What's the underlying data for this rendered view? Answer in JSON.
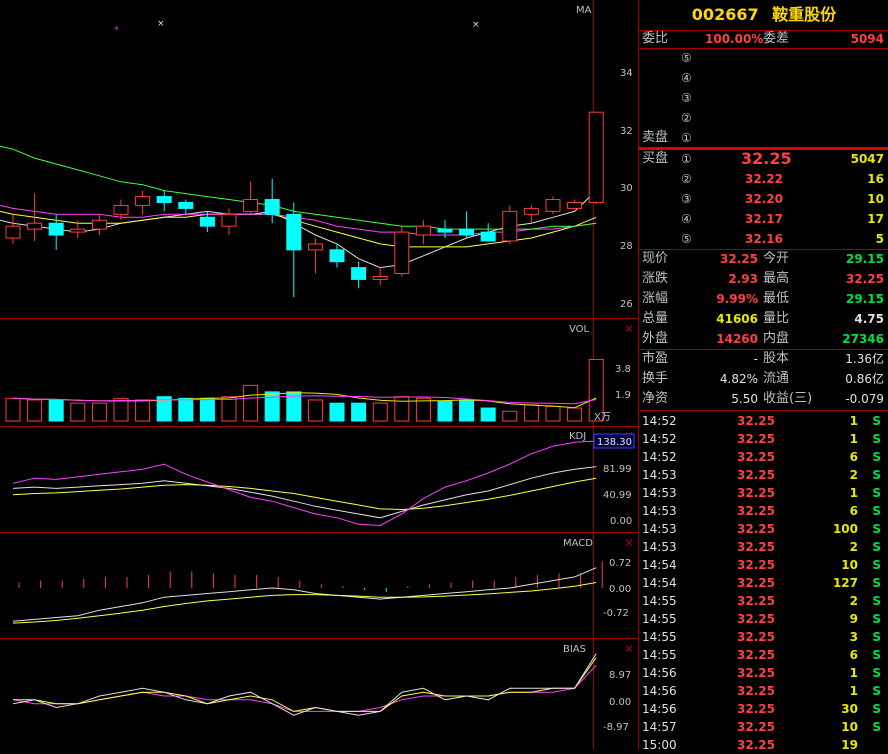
{
  "stock": {
    "code": "002667",
    "name": "鞍重股份"
  },
  "weibi": {
    "label1": "委比",
    "value1": "100.00%",
    "label2": "委差",
    "value2": "5094"
  },
  "sell": {
    "label": "卖盘",
    "levels": [
      {
        "idx": "⑤",
        "price": "",
        "vol": ""
      },
      {
        "idx": "④",
        "price": "",
        "vol": ""
      },
      {
        "idx": "③",
        "price": "",
        "vol": ""
      },
      {
        "idx": "②",
        "price": "",
        "vol": ""
      },
      {
        "idx": "①",
        "price": "",
        "vol": ""
      }
    ]
  },
  "buy": {
    "label": "买盘",
    "levels": [
      {
        "idx": "①",
        "price": "32.25",
        "vol": "5047"
      },
      {
        "idx": "②",
        "price": "32.22",
        "vol": "16"
      },
      {
        "idx": "③",
        "price": "32.20",
        "vol": "10"
      },
      {
        "idx": "④",
        "price": "32.17",
        "vol": "17"
      },
      {
        "idx": "⑤",
        "price": "32.16",
        "vol": "5"
      }
    ]
  },
  "quote": [
    {
      "l1": "现价",
      "v1": "32.25",
      "c1": "red",
      "l2": "今开",
      "v2": "29.15",
      "c2": "green"
    },
    {
      "l1": "涨跌",
      "v1": "2.93",
      "c1": "red",
      "l2": "最高",
      "v2": "32.25",
      "c2": "red"
    },
    {
      "l1": "涨幅",
      "v1": "9.99%",
      "c1": "red",
      "l2": "最低",
      "v2": "29.15",
      "c2": "green"
    },
    {
      "l1": "总量",
      "v1": "41606",
      "c1": "yellow",
      "l2": "量比",
      "v2": "4.75",
      "c2": "white"
    },
    {
      "l1": "外盘",
      "v1": "14260",
      "c1": "red",
      "l2": "内盘",
      "v2": "27346",
      "c2": "green"
    }
  ],
  "fund": [
    {
      "l1": "市盈",
      "v1": "-",
      "l2": "股本",
      "v2": "1.36亿"
    },
    {
      "l1": "换手",
      "v1": "4.82%",
      "l2": "流通",
      "v2": "0.86亿"
    },
    {
      "l1": "净资",
      "v1": "5.50",
      "l2": "收益(三)",
      "v2": "-0.079"
    }
  ],
  "ticks": [
    {
      "time": "14:52",
      "price": "32.25",
      "vol": "1",
      "side": "S"
    },
    {
      "time": "14:52",
      "price": "32.25",
      "vol": "1",
      "side": "S"
    },
    {
      "time": "14:52",
      "price": "32.25",
      "vol": "6",
      "side": "S"
    },
    {
      "time": "14:53",
      "price": "32.25",
      "vol": "2",
      "side": "S"
    },
    {
      "time": "14:53",
      "price": "32.25",
      "vol": "1",
      "side": "S"
    },
    {
      "time": "14:53",
      "price": "32.25",
      "vol": "6",
      "side": "S"
    },
    {
      "time": "14:53",
      "price": "32.25",
      "vol": "100",
      "side": "S"
    },
    {
      "time": "14:53",
      "price": "32.25",
      "vol": "2",
      "side": "S"
    },
    {
      "time": "14:54",
      "price": "32.25",
      "vol": "10",
      "side": "S"
    },
    {
      "time": "14:54",
      "price": "32.25",
      "vol": "127",
      "side": "S"
    },
    {
      "time": "14:55",
      "price": "32.25",
      "vol": "2",
      "side": "S"
    },
    {
      "time": "14:55",
      "price": "32.25",
      "vol": "9",
      "side": "S"
    },
    {
      "time": "14:55",
      "price": "32.25",
      "vol": "3",
      "side": "S"
    },
    {
      "time": "14:55",
      "price": "32.25",
      "vol": "6",
      "side": "S"
    },
    {
      "time": "14:56",
      "price": "32.25",
      "vol": "1",
      "side": "S"
    },
    {
      "time": "14:56",
      "price": "32.25",
      "vol": "1",
      "side": "S"
    },
    {
      "time": "14:56",
      "price": "32.25",
      "vol": "30",
      "side": "S"
    },
    {
      "time": "14:57",
      "price": "32.25",
      "vol": "10",
      "side": "S"
    },
    {
      "time": "15:00",
      "price": "32.25",
      "vol": "19",
      "side": ""
    }
  ],
  "panels": {
    "ma": {
      "label": "MA",
      "ticks": [
        "34",
        "32",
        "30",
        "28",
        "26"
      ]
    },
    "vol": {
      "label": "VOL",
      "ticks": [
        "3.8",
        "1.9"
      ],
      "unit": "X万"
    },
    "kdj": {
      "label": "KDJ",
      "ticks": [
        "81.99",
        "40.99",
        "0.00"
      ],
      "current": "138.30"
    },
    "macd": {
      "label": "MACD",
      "ticks": [
        "0.72",
        "0.00",
        "-0.72"
      ]
    },
    "bias": {
      "label": "BIAS",
      "ticks": [
        "8.97",
        "0.00",
        "-8.97"
      ]
    }
  },
  "chart_data": {
    "type": "candlestick",
    "ylim": [
      25.5,
      35.5
    ],
    "candles": [
      {
        "o": 28.0,
        "h": 28.8,
        "l": 27.8,
        "c": 28.4
      },
      {
        "o": 28.3,
        "h": 29.5,
        "l": 27.9,
        "c": 28.5
      },
      {
        "o": 28.5,
        "h": 28.8,
        "l": 27.6,
        "c": 28.1
      },
      {
        "o": 28.2,
        "h": 28.6,
        "l": 28.0,
        "c": 28.3
      },
      {
        "o": 28.3,
        "h": 28.8,
        "l": 28.1,
        "c": 28.6
      },
      {
        "o": 28.8,
        "h": 29.3,
        "l": 28.6,
        "c": 29.1
      },
      {
        "o": 29.1,
        "h": 29.6,
        "l": 28.8,
        "c": 29.4
      },
      {
        "o": 29.4,
        "h": 29.6,
        "l": 28.9,
        "c": 29.2
      },
      {
        "o": 29.2,
        "h": 29.3,
        "l": 28.8,
        "c": 29.0
      },
      {
        "o": 28.7,
        "h": 28.9,
        "l": 28.2,
        "c": 28.4
      },
      {
        "o": 28.4,
        "h": 29.0,
        "l": 28.1,
        "c": 28.8
      },
      {
        "o": 28.9,
        "h": 29.9,
        "l": 28.8,
        "c": 29.3
      },
      {
        "o": 29.3,
        "h": 30.0,
        "l": 28.5,
        "c": 28.8
      },
      {
        "o": 28.8,
        "h": 29.2,
        "l": 26.0,
        "c": 27.6
      },
      {
        "o": 27.6,
        "h": 28.0,
        "l": 26.8,
        "c": 27.8
      },
      {
        "o": 27.6,
        "h": 27.8,
        "l": 27.0,
        "c": 27.2
      },
      {
        "o": 27.0,
        "h": 27.2,
        "l": 26.3,
        "c": 26.6
      },
      {
        "o": 26.6,
        "h": 27.0,
        "l": 26.4,
        "c": 26.7
      },
      {
        "o": 26.8,
        "h": 28.4,
        "l": 26.7,
        "c": 28.2
      },
      {
        "o": 28.1,
        "h": 28.6,
        "l": 27.8,
        "c": 28.4
      },
      {
        "o": 28.3,
        "h": 28.6,
        "l": 28.0,
        "c": 28.2
      },
      {
        "o": 28.3,
        "h": 28.9,
        "l": 28.0,
        "c": 28.1
      },
      {
        "o": 28.2,
        "h": 28.5,
        "l": 27.9,
        "c": 27.9
      },
      {
        "o": 27.9,
        "h": 29.1,
        "l": 27.8,
        "c": 28.9
      },
      {
        "o": 28.8,
        "h": 29.1,
        "l": 28.5,
        "c": 29.0
      },
      {
        "o": 28.9,
        "h": 29.4,
        "l": 28.8,
        "c": 29.3
      },
      {
        "o": 29.0,
        "h": 29.3,
        "l": 29.0,
        "c": 29.2
      },
      {
        "o": 29.2,
        "h": 32.25,
        "l": 29.15,
        "c": 32.25
      }
    ],
    "ma": [
      {
        "color": "#e0e0e0",
        "values": [
          28.5,
          28.4,
          28.3,
          28.2,
          28.3,
          28.5,
          28.6,
          28.7,
          28.8,
          28.9,
          28.8,
          28.8,
          28.9,
          28.5,
          28.1,
          27.8,
          27.3,
          27.0,
          27.1,
          27.4,
          27.7,
          28.0,
          28.2,
          28.4,
          28.5,
          28.7,
          28.9,
          29.6
        ]
      },
      {
        "color": "#ffff40",
        "values": [
          28.8,
          28.7,
          28.6,
          28.5,
          28.5,
          28.5,
          28.6,
          28.7,
          28.7,
          28.8,
          28.8,
          28.8,
          28.8,
          28.6,
          28.4,
          28.2,
          28.0,
          27.8,
          27.7,
          27.7,
          27.7,
          27.7,
          27.8,
          27.9,
          28.0,
          28.2,
          28.4,
          28.7
        ]
      },
      {
        "color": "#ff40ff",
        "values": [
          29.0,
          28.9,
          28.8,
          28.8,
          28.8,
          28.7,
          28.7,
          28.8,
          28.8,
          28.8,
          28.8,
          28.8,
          28.8,
          28.7,
          28.6,
          28.4,
          28.3,
          28.2,
          28.2,
          28.1,
          28.1,
          28.1,
          28.2,
          28.2,
          28.3,
          28.3,
          28.4,
          28.5
        ]
      },
      {
        "color": "#40ff40",
        "values": [
          31.0,
          30.7,
          30.5,
          30.3,
          30.1,
          29.9,
          29.8,
          29.6,
          29.5,
          29.4,
          29.3,
          29.2,
          29.1,
          28.9,
          28.8,
          28.7,
          28.6,
          28.5,
          28.4,
          28.4,
          28.3,
          28.3,
          28.3,
          28.3,
          28.3,
          28.4,
          28.4,
          28.5
        ]
      }
    ],
    "volume": {
      "ylim": [
        0,
        5.0
      ],
      "values": [
        1.4,
        1.3,
        1.3,
        1.1,
        1.1,
        1.4,
        1.3,
        1.5,
        1.4,
        1.4,
        1.5,
        2.2,
        1.8,
        1.8,
        1.3,
        1.1,
        1.1,
        1.1,
        1.5,
        1.4,
        1.2,
        1.3,
        0.8,
        0.6,
        1.0,
        0.9,
        0.8,
        3.8
      ]
    },
    "kdj": {
      "ylim": [
        -5,
        145
      ],
      "k": [
        60,
        62,
        60,
        62,
        64,
        66,
        68,
        72,
        68,
        64,
        60,
        54,
        48,
        40,
        32,
        26,
        20,
        14,
        24,
        34,
        42,
        50,
        56,
        66,
        76,
        84,
        90,
        94
      ],
      "d": [
        50,
        52,
        53,
        55,
        57,
        59,
        62,
        65,
        66,
        65,
        63,
        60,
        56,
        52,
        46,
        40,
        34,
        28,
        27,
        29,
        33,
        38,
        43,
        49,
        56,
        63,
        70,
        76
      ],
      "j": [
        68,
        76,
        74,
        78,
        82,
        86,
        90,
        98,
        82,
        70,
        58,
        46,
        40,
        30,
        20,
        14,
        4,
        2,
        20,
        44,
        62,
        72,
        84,
        98,
        114,
        126,
        132,
        134
      ]
    },
    "macd": {
      "ylim": [
        -1.3,
        1.3
      ],
      "hist": [
        0.15,
        0.2,
        0.2,
        0.25,
        0.3,
        0.3,
        0.35,
        0.45,
        0.45,
        0.4,
        0.35,
        0.35,
        0.3,
        0.2,
        0.1,
        0.05,
        -0.05,
        -0.1,
        0.05,
        0.1,
        0.15,
        0.2,
        0.2,
        0.3,
        0.35,
        0.4,
        0.4,
        0.72
      ],
      "dif": [
        -0.9,
        -0.85,
        -0.8,
        -0.75,
        -0.6,
        -0.5,
        -0.4,
        -0.25,
        -0.2,
        -0.15,
        -0.1,
        -0.05,
        0.0,
        -0.05,
        -0.15,
        -0.2,
        -0.25,
        -0.3,
        -0.25,
        -0.2,
        -0.15,
        -0.1,
        -0.05,
        0.0,
        0.1,
        0.2,
        0.3,
        0.55
      ],
      "dea": [
        -0.95,
        -0.92,
        -0.88,
        -0.82,
        -0.75,
        -0.68,
        -0.6,
        -0.5,
        -0.42,
        -0.35,
        -0.3,
        -0.25,
        -0.2,
        -0.18,
        -0.18,
        -0.2,
        -0.22,
        -0.25,
        -0.25,
        -0.24,
        -0.22,
        -0.19,
        -0.16,
        -0.12,
        -0.08,
        -0.02,
        0.05,
        0.15
      ]
    },
    "bias": {
      "ylim": [
        -13,
        13
      ],
      "b1": [
        -2,
        -1,
        -3,
        -2,
        0,
        1,
        2,
        1,
        -1,
        -2,
        0,
        1,
        -2,
        -5,
        -3,
        -4,
        -5,
        -4,
        1,
        2,
        -1,
        0,
        -1,
        2,
        2,
        2,
        2,
        11
      ],
      "b2": [
        -1,
        -1,
        -2,
        -2,
        -1,
        0,
        1,
        1,
        0,
        -2,
        -1,
        0,
        -1,
        -4,
        -3,
        -4,
        -4,
        -4,
        0,
        1,
        0,
        0,
        0,
        1,
        1,
        2,
        2,
        10
      ],
      "b3": [
        -1,
        -2,
        -2,
        -2,
        -1,
        0,
        1,
        0,
        0,
        -1,
        -1,
        -1,
        -2,
        -4,
        -4,
        -4,
        -4,
        -3,
        -1,
        0,
        0,
        0,
        0,
        1,
        1,
        1,
        2,
        8
      ]
    }
  }
}
